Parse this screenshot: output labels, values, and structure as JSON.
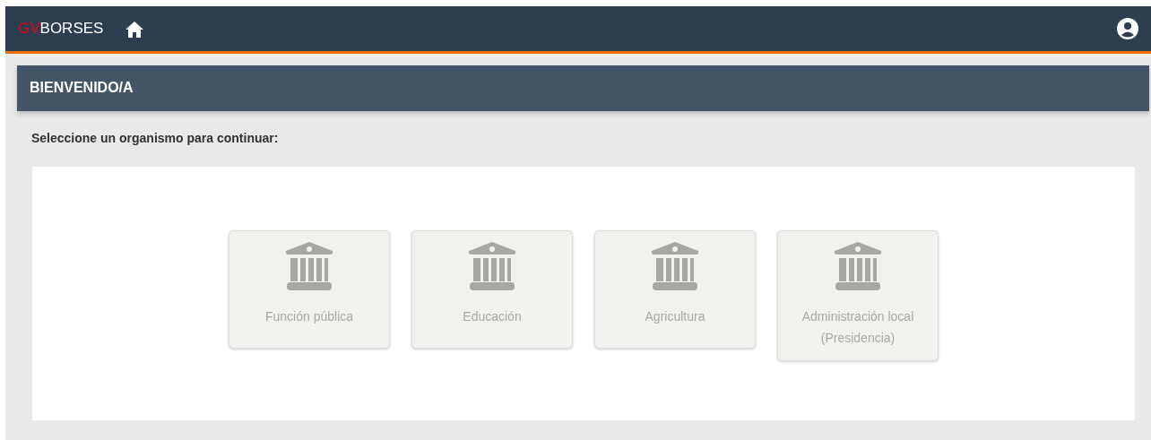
{
  "navbar": {
    "logo": {
      "prefix": "GV",
      "name": "BORSES"
    }
  },
  "header": {
    "title": "BIENVENIDO/A"
  },
  "prompt": "Seleccione un organismo para continuar:",
  "organisms": [
    {
      "label": "Función pública"
    },
    {
      "label": "Educación"
    },
    {
      "label": "Agricultura"
    },
    {
      "label": "Administración local (Presidencia)"
    }
  ]
}
